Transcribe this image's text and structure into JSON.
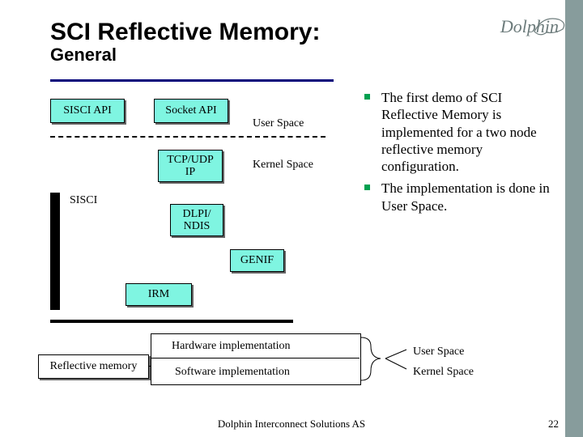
{
  "title": {
    "main": "SCI Reflective Memory:",
    "sub": "General"
  },
  "logo_text": "Dolphin",
  "diagram": {
    "sisci_api": "SISCI API",
    "socket_api": "Socket API",
    "user_space": "User Space",
    "tcp_udp_ip": "TCP/UDP\nIP",
    "kernel_space": "Kernel Space",
    "sisci": "SISCI",
    "dlpi_ndis": "DLPI/\nNDIS",
    "genif": "GENIF",
    "irm": "IRM"
  },
  "bullets": {
    "0": "The first demo of SCI Reflective Memory is implemented for a two node reflective memory configuration.",
    "1": "The implementation is done in User Space."
  },
  "lower": {
    "hw": "Hardware implementation",
    "sw": "Software implementation",
    "refl": "Reflective memory",
    "us": "User Space",
    "ks": "Kernel Space"
  },
  "footer": "Dolphin Interconnect Solutions AS",
  "page": "22"
}
